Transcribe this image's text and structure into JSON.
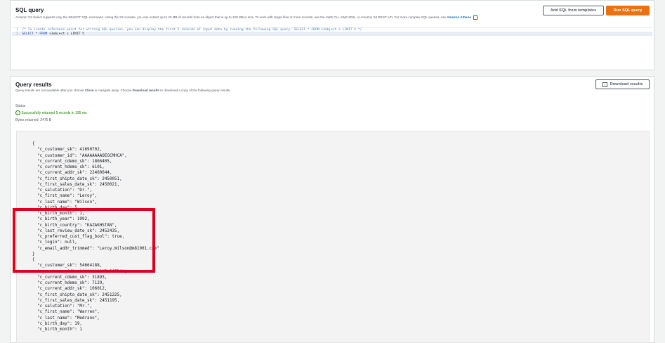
{
  "sql_panel": {
    "title": "SQL query",
    "description": "Amazon S3 Select supports only the SELECT SQL command. Using the S3 console, you can extract up to 40 MB of records from an object that is up to 128 MB in size. To work with larger files or more records, use the AWS CLI, AWS SDK, or Amazon S3 REST API. For more complex SQL queries, use",
    "athena_link": "Amazon Athena",
    "add_templates_label": "Add SQL from templates",
    "run_label": "Run SQL query",
    "editor_lines": [
      {
        "num": "1",
        "text": "/* To create reference point for writing SQL queries, you can display the first 5 records of input data by running the following SQL query: SELECT * FROM s3object s LIMIT 5 */"
      },
      {
        "num": "2",
        "kw1": "SELECT",
        "mid": " * ",
        "kw2": "FROM",
        "rest": " s3object s LIMIT 5"
      }
    ]
  },
  "results_panel": {
    "title": "Query results",
    "desc_pre": "Query results are not available after you choose ",
    "desc_close": "Close",
    "desc_mid": " or navigate away. Choose ",
    "desc_download": "Download results",
    "desc_post": " to download a copy of the following query results.",
    "download_label": "Download results",
    "status_label": "Status",
    "status_text": "Successfully returned 5 records in 195 ms",
    "bytes_label": "Bytes returned: 2475 B",
    "json_text": "{\n  \"c_customer_sk\": 41690702,\n  \"c_customer_id\": \"AAAAAAAAOEGCMHCA\",\n  \"c_current_cdemo_sk\": 1866405,\n  \"c_current_hdemo_sk\": 6101,\n  \"c_current_addr_sk\": 22460644,\n  \"c_first_shipto_date_sk\": 2450051,\n  \"c_first_sales_date_sk\": 2450021,\n  \"c_salutation\": \"Dr.\",\n  \"c_first_name\": \"Leroy\",\n  \"c_last_name\": \"Wilson\",\n  \"c_birth_day\": 5,\n  \"c_birth_month\": 1,\n  \"c_birth_year\": 1992,\n  \"c_birth_country\": \"KAZAKHSTAN\",\n  \"c_last_review_date_sk\": 2452435,\n  \"c_preferred_cust_flag_bool\": true,\n  \"c_login\": null,\n  \"c_email_addr_trimmed\": \"Leroy.Wilson@m81901.com\"\n}\n{\n  \"c_customer_sk\": 54664188,\n  \"c_customer_id\": \"AAAAAAAAMPLBCEDA\",\n  \"c_current_cdemo_sk\": 31893,\n  \"c_current_hdemo_sk\": 7129,\n  \"c_current_addr_sk\": 106012,\n  \"c_first_shipto_date_sk\": 2451225,\n  \"c_first_sales_date_sk\": 2451195,\n  \"c_salutation\": \"Mr.\",\n  \"c_first_name\": \"Warren\",\n  \"c_last_name\": \"Medrano\",\n  \"c_birth_day\": 19,\n  \"c_birth_month\": 1"
  },
  "colors": {
    "accent_orange": "#ec7211",
    "link_blue": "#0073bb",
    "success_green": "#1d8102",
    "highlight_red": "#e0001b"
  }
}
